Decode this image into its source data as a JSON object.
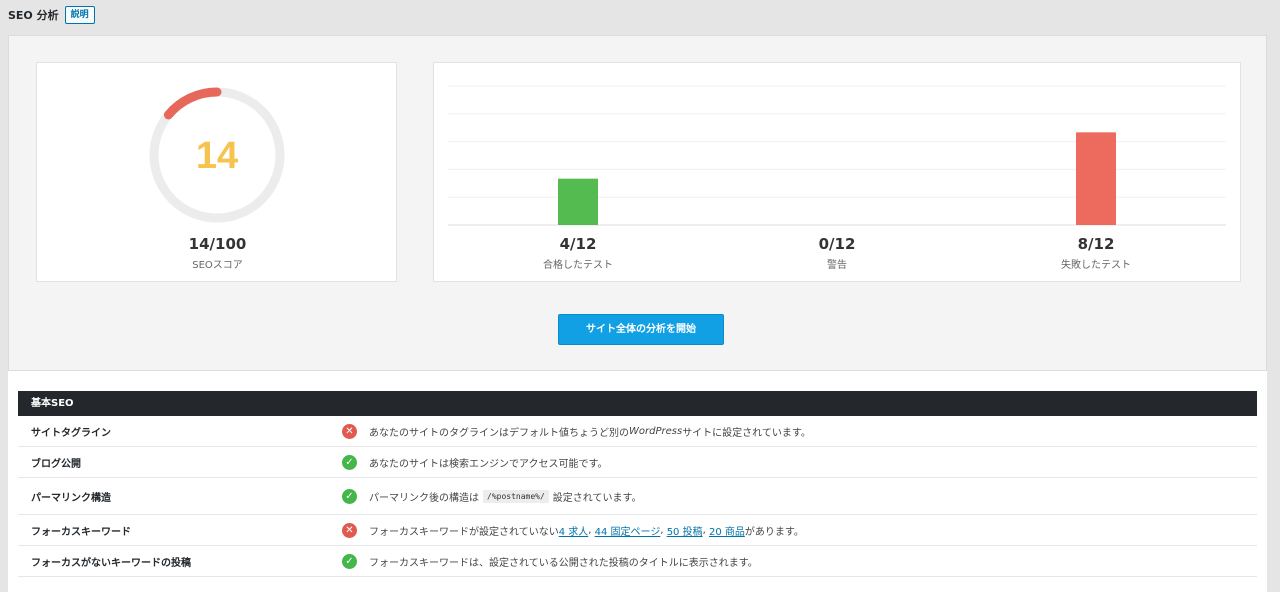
{
  "header": {
    "title": "SEO 分析",
    "help_label": "説明"
  },
  "score": {
    "value": "14",
    "fraction": "14/100",
    "label": "SEOスコア",
    "percent": 14,
    "color": "#f5c34e",
    "ring_color": "#e8675b"
  },
  "chart_data": {
    "type": "bar",
    "categories": [
      "合格したテスト",
      "警告",
      "失敗したテスト"
    ],
    "values": [
      4,
      0,
      8
    ],
    "ylim": [
      0,
      12
    ],
    "value_labels": [
      "4/12",
      "0/12",
      "8/12"
    ],
    "colors": [
      "#54bb50",
      "#f5c34e",
      "#ec6a5e"
    ],
    "grid": true
  },
  "actions": {
    "start_label": "サイト全体の分析を開始"
  },
  "basic_seo": {
    "heading": "基本SEO",
    "rows": [
      {
        "label": "サイトタグライン",
        "status": "fail",
        "text_a": "あなたのサイトのタグラインはデフォルト値ちょうど別の",
        "text_italic": "WordPress",
        "text_b": "サイトに設定されています。"
      },
      {
        "label": "ブログ公開",
        "status": "pass",
        "text": "あなたのサイトは検索エンジンでアクセス可能です。"
      },
      {
        "label": "パーマリンク構造",
        "status": "pass",
        "text_a": "パーマリンク後の構造は",
        "code": "/%postname%/",
        "text_b": "設定されています。"
      },
      {
        "label": "フォーカスキーワード",
        "status": "fail",
        "text_a": "フォーカスキーワードが設定されていない",
        "links": [
          "4 求人",
          "44 固定ページ",
          "50 投稿",
          "20 商品"
        ],
        "text_b": "があります。"
      },
      {
        "label": "フォーカスがないキーワードの投稿",
        "status": "pass",
        "text": "フォーカスキーワードは、設定されている公開された投稿のタイトルに表示されます。"
      }
    ]
  }
}
